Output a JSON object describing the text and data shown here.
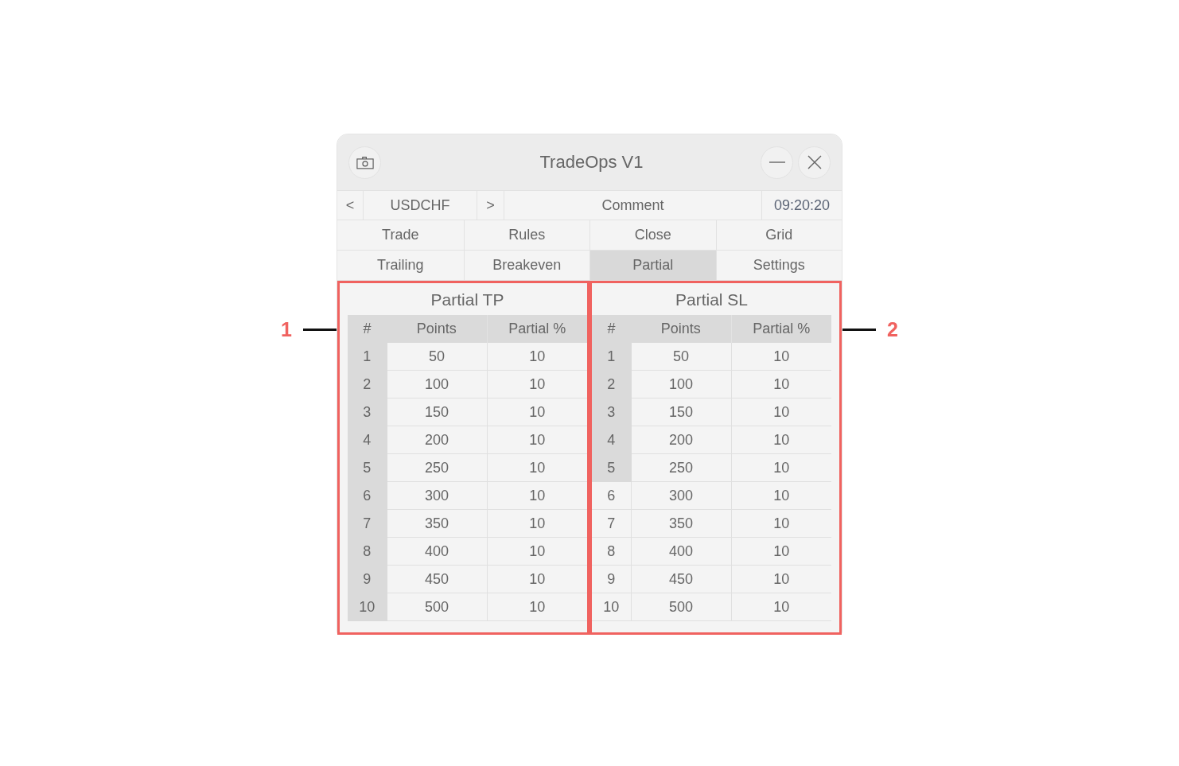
{
  "window": {
    "title": "TradeOps V1"
  },
  "nav_bar": {
    "prev": "<",
    "symbol": "USDCHF",
    "next": ">",
    "comment": "Comment",
    "time": "09:20:20"
  },
  "tabs": [
    {
      "label": "Trade",
      "selected": false
    },
    {
      "label": "Rules",
      "selected": false
    },
    {
      "label": "Close",
      "selected": false
    },
    {
      "label": "Grid",
      "selected": false
    },
    {
      "label": "Trailing",
      "selected": false
    },
    {
      "label": "Breakeven",
      "selected": false
    },
    {
      "label": "Partial",
      "selected": true
    },
    {
      "label": "Settings",
      "selected": false
    }
  ],
  "panels": [
    {
      "title": "Partial TP",
      "callout": {
        "label": "1",
        "kind": "left"
      },
      "columns": [
        "#",
        "Points",
        "Partial %"
      ],
      "rows": [
        {
          "cells": [
            "1",
            "50",
            "10"
          ],
          "highlighted": true
        },
        {
          "cells": [
            "2",
            "100",
            "10"
          ],
          "highlighted": true
        },
        {
          "cells": [
            "3",
            "150",
            "10"
          ],
          "highlighted": true
        },
        {
          "cells": [
            "4",
            "200",
            "10"
          ],
          "highlighted": true
        },
        {
          "cells": [
            "5",
            "250",
            "10"
          ],
          "highlighted": true
        },
        {
          "cells": [
            "6",
            "300",
            "10"
          ],
          "highlighted": true
        },
        {
          "cells": [
            "7",
            "350",
            "10"
          ],
          "highlighted": true
        },
        {
          "cells": [
            "8",
            "400",
            "10"
          ],
          "highlighted": true
        },
        {
          "cells": [
            "9",
            "450",
            "10"
          ],
          "highlighted": true
        },
        {
          "cells": [
            "10",
            "500",
            "10"
          ],
          "highlighted": true
        }
      ]
    },
    {
      "title": "Partial SL",
      "callout": {
        "label": "2",
        "kind": "right"
      },
      "columns": [
        "#",
        "Points",
        "Partial %"
      ],
      "rows": [
        {
          "cells": [
            "1",
            "50",
            "10"
          ],
          "highlighted": true
        },
        {
          "cells": [
            "2",
            "100",
            "10"
          ],
          "highlighted": true
        },
        {
          "cells": [
            "3",
            "150",
            "10"
          ],
          "highlighted": true
        },
        {
          "cells": [
            "4",
            "200",
            "10"
          ],
          "highlighted": true
        },
        {
          "cells": [
            "5",
            "250",
            "10"
          ],
          "highlighted": true
        },
        {
          "cells": [
            "6",
            "300",
            "10"
          ],
          "highlighted": false
        },
        {
          "cells": [
            "7",
            "350",
            "10"
          ],
          "highlighted": false
        },
        {
          "cells": [
            "8",
            "400",
            "10"
          ],
          "highlighted": false
        },
        {
          "cells": [
            "9",
            "450",
            "10"
          ],
          "highlighted": false
        },
        {
          "cells": [
            "10",
            "500",
            "10"
          ],
          "highlighted": false
        }
      ]
    }
  ]
}
